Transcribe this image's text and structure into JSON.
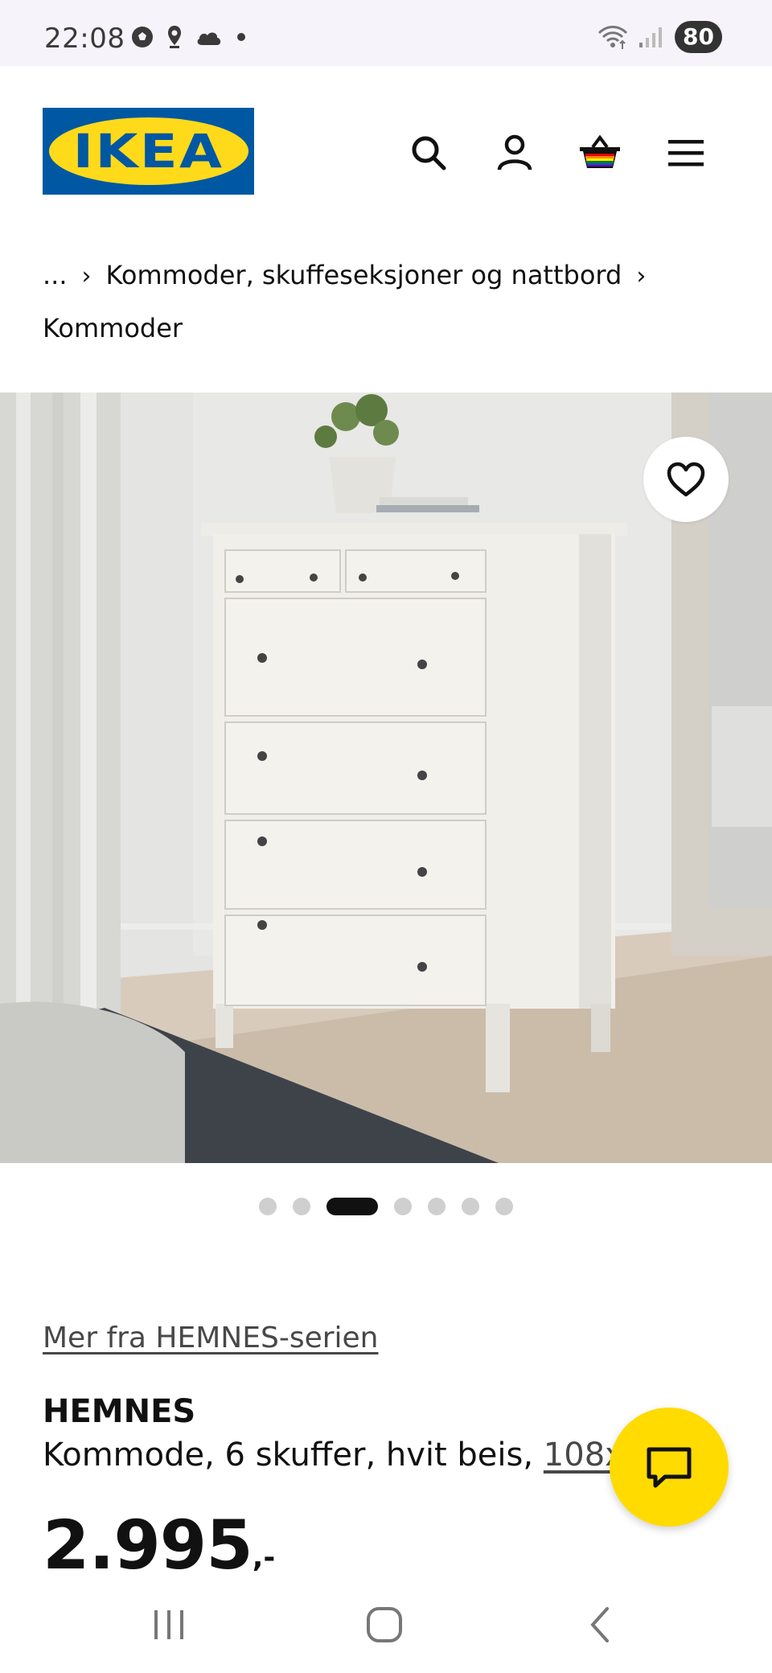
{
  "status_bar": {
    "time": "22:08",
    "battery": "80",
    "left_icons": [
      "soccer-ball-icon",
      "location-icon",
      "cloud-icon",
      "dot-icon"
    ],
    "right_icons": [
      "wifi-icon",
      "signal-icon"
    ]
  },
  "header": {
    "logo_text": "IKEA",
    "icons": [
      "search-icon",
      "account-icon",
      "cart-icon",
      "menu-icon"
    ]
  },
  "breadcrumb": {
    "ellipsis": "...",
    "parent": "Kommoder, skuffeseksjoner og nattbord",
    "current": "Kommoder"
  },
  "carousel": {
    "total": 7,
    "active_index": 2
  },
  "product": {
    "series_link": "Mer fra HEMNES-serien",
    "name": "HEMNES",
    "description": "Kommode, 6 skuffer, hvit beis, ",
    "dimensions": "108x131 cm",
    "price": "2.995",
    "price_suffix": ",-"
  },
  "colors": {
    "ikea_blue": "#0058a3",
    "ikea_yellow": "#ffda1a",
    "chat_yellow": "#ffdb00"
  }
}
